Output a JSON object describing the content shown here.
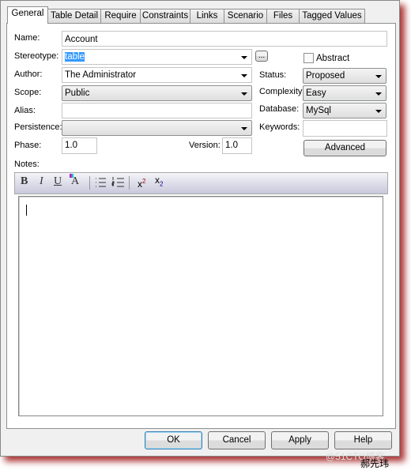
{
  "tabs": [
    "General",
    "Table Detail",
    "Require",
    "Constraints",
    "Links",
    "Scenario",
    "Files",
    "Tagged Values"
  ],
  "form": {
    "name_label": "Name:",
    "name_value": "Account",
    "stereotype_label": "Stereotype:",
    "stereotype_value": "table",
    "stereotype_browse": "...",
    "abstract_label": "Abstract",
    "abstract_checked": false,
    "author_label": "Author:",
    "author_value": "The Administrator",
    "status_label": "Status:",
    "status_value": "Proposed",
    "scope_label": "Scope:",
    "scope_value": "Public",
    "complexity_label": "Complexity:",
    "complexity_value": "Easy",
    "alias_label": "Alias:",
    "alias_value": "",
    "database_label": "Database:",
    "database_value": "MySql",
    "persistence_label": "Persistence:",
    "persistence_value": "",
    "keywords_label": "Keywords:",
    "keywords_value": "",
    "phase_label": "Phase:",
    "phase_value": "1.0",
    "version_label": "Version:",
    "version_value": "1.0",
    "advanced_label": "Advanced",
    "notes_label": "Notes:"
  },
  "toolbar": {
    "bold": "B",
    "italic": "I",
    "underline": "U",
    "font_color": "A",
    "superscript": "x",
    "sup_mark": "2",
    "subscript": "x",
    "sub_mark": "2"
  },
  "buttons": {
    "ok": "OK",
    "cancel": "Cancel",
    "apply": "Apply",
    "help": "Help"
  },
  "watermark": "@51CTO博客",
  "signature": "郝先玮"
}
